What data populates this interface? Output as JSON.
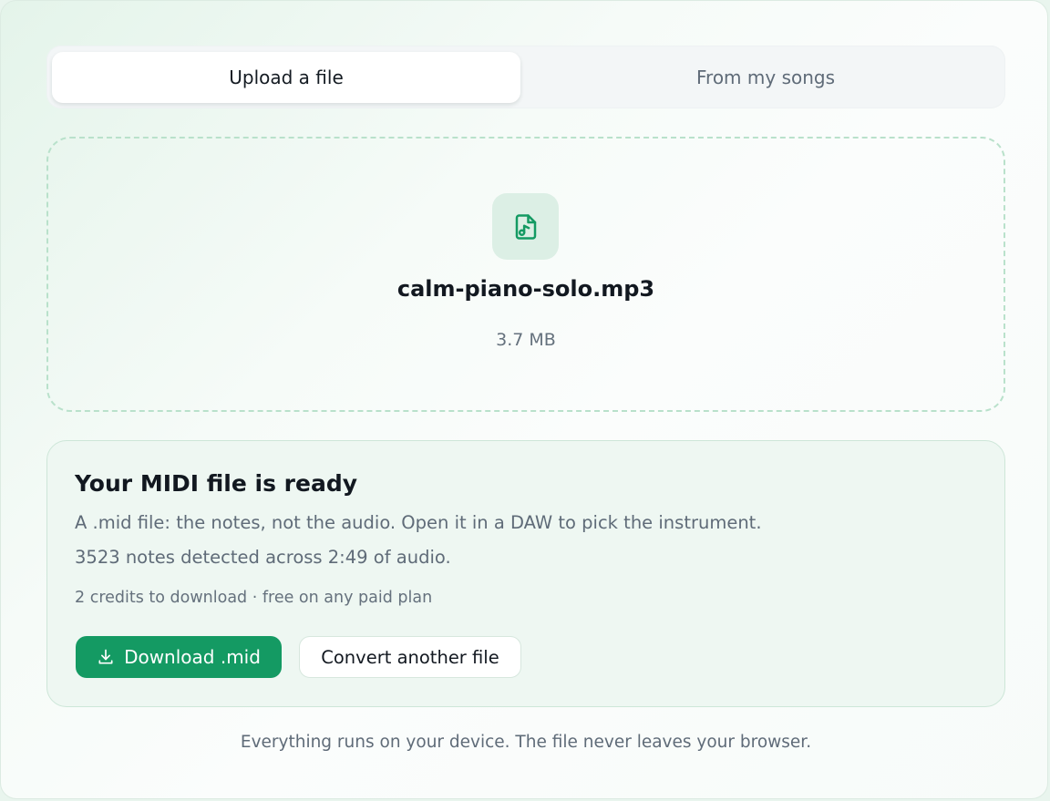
{
  "tabs": {
    "upload": "Upload a file",
    "songs": "From my songs"
  },
  "file": {
    "icon": "music-file-icon",
    "name": "calm-piano-solo.mp3",
    "size": "3.7 MB"
  },
  "result": {
    "title": "Your MIDI file is ready",
    "description": "A .mid file: the notes, not the audio. Open it in a DAW to pick the instrument.",
    "stats": "3523 notes detected across 2:49 of audio.",
    "credits": "2 credits to download · free on any paid plan",
    "download_label": "Download .mid",
    "convert_label": "Convert another file"
  },
  "footer": {
    "note": "Everything runs on your device. The file never leaves your browser."
  },
  "colors": {
    "accent": "#149a63",
    "dropzone_border": "#b9e1cb",
    "icon_bg": "#dcefe5"
  }
}
